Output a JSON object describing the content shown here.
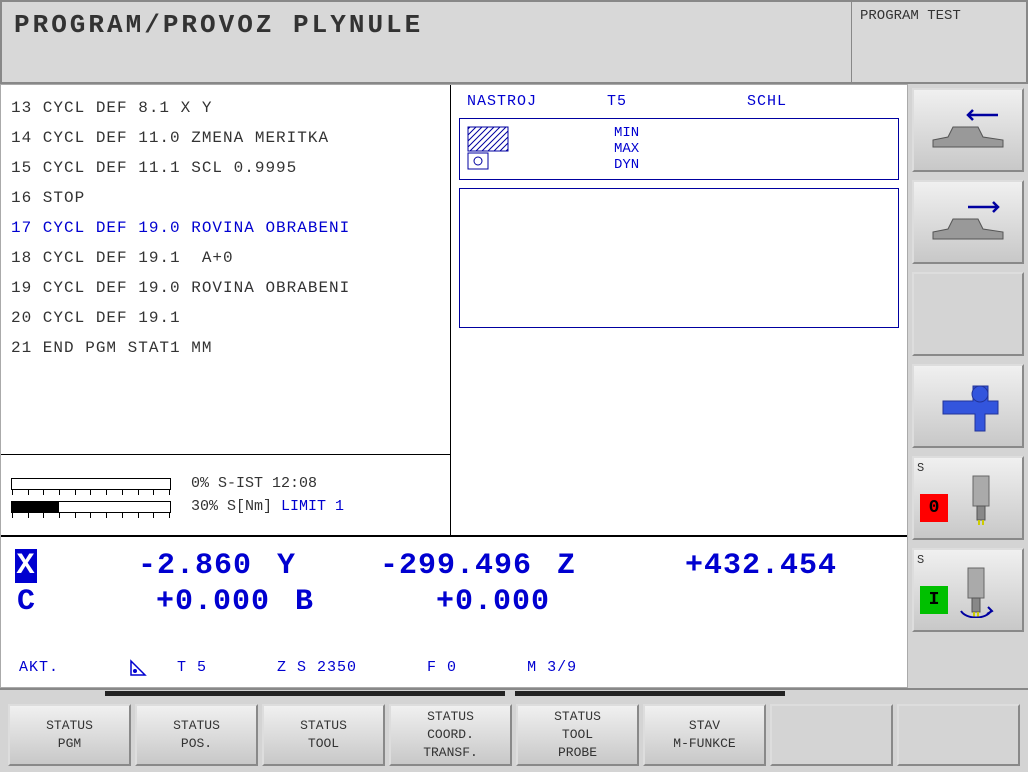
{
  "header": {
    "title": "PROGRAM/PROVOZ PLYNULE",
    "right": "PROGRAM TEST"
  },
  "program": {
    "lines": [
      {
        "n": "13",
        "text": "CYCL DEF 8.1 X Y",
        "hl": false
      },
      {
        "n": "14",
        "text": "CYCL DEF 11.0 ZMENA MERITKA",
        "hl": false
      },
      {
        "n": "15",
        "text": "CYCL DEF 11.1 SCL 0.9995",
        "hl": false
      },
      {
        "n": "16",
        "text": "STOP",
        "hl": false
      },
      {
        "n": "17",
        "text": "CYCL DEF 19.0 ROVINA OBRABENI",
        "hl": true
      },
      {
        "n": "18",
        "text": "CYCL DEF 19.1  A+0",
        "hl": false
      },
      {
        "n": "19",
        "text": "CYCL DEF 19.0 ROVINA OBRABENI",
        "hl": false
      },
      {
        "n": "20",
        "text": "CYCL DEF 19.1",
        "hl": false
      },
      {
        "n": "21",
        "text": "END PGM STAT1 MM",
        "hl": false
      }
    ]
  },
  "tool": {
    "label_tool": "NASTROJ",
    "tool_id": "T5",
    "tool_name": "SCHL",
    "min": "MIN",
    "max": "MAX",
    "dyn": "DYN"
  },
  "bars": {
    "bar1_pct": 0,
    "bar1_text": "0% S-IST 12:08",
    "bar2_pct": 30,
    "bar2_text": "30% S[Nm] ",
    "bar2_limit": "LIMIT 1"
  },
  "coords": {
    "x": {
      "axis": "X",
      "val": "-2.860"
    },
    "y": {
      "axis": "Y",
      "val": "-299.496"
    },
    "z": {
      "axis": "Z",
      "val": "+432.454"
    },
    "c": {
      "axis": "C",
      "val": "+0.000"
    },
    "b": {
      "axis": "B",
      "val": "+0.000"
    }
  },
  "status": {
    "mode": "AKT.",
    "t": "T 5",
    "zs": "Z S 2350",
    "f": "F 0",
    "m": "M 3/9"
  },
  "side": {
    "s1_label": "S",
    "s1_val": "0",
    "s2_label": "S",
    "s2_val": "I"
  },
  "softkeys": [
    {
      "l1": "STATUS",
      "l2": "PGM"
    },
    {
      "l1": "STATUS",
      "l2": "POS."
    },
    {
      "l1": "STATUS",
      "l2": "TOOL"
    },
    {
      "l1": "STATUS",
      "l2": "COORD.",
      "l3": "TRANSF."
    },
    {
      "l1": "STATUS",
      "l2": "TOOL",
      "l3": "PROBE"
    },
    {
      "l1": "STAV",
      "l2": "M-FUNKCE"
    },
    {
      "empty": true
    },
    {
      "empty": true
    }
  ]
}
